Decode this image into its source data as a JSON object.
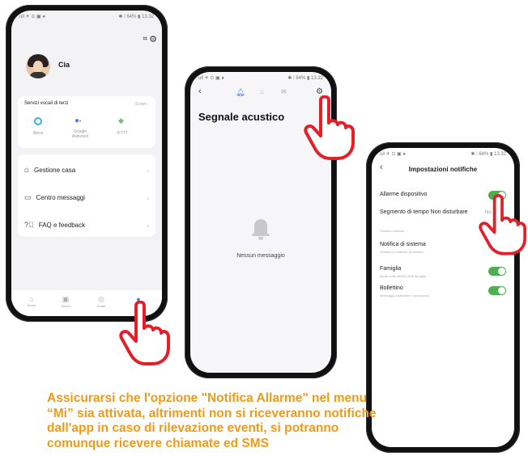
{
  "status_bar": {
    "left": "ull ✈ ⊙ ▣ ●",
    "right": "✱ ⁞ 64% ▮ 13.32"
  },
  "phone1": {
    "user_name": "Cia",
    "voice_services": {
      "title": "Servizi vocali di terzi",
      "more": "Scopri  ›",
      "items": [
        "Alexa",
        "Google Assistant",
        "IFTTT"
      ]
    },
    "menu": [
      "Gestione casa",
      "Centro messaggi",
      "FAQ e feedback"
    ],
    "nav": [
      "Home",
      "Scene",
      "Smart",
      "Mi"
    ]
  },
  "phone2": {
    "title": "Segnale acustico",
    "empty_message": "Nessun messaggio"
  },
  "phone3": {
    "header": "Impostazioni notifiche",
    "alarm_label": "Allarme dispositivo",
    "dnd_label": "Segmento di tempo Non disturbare",
    "dnd_value": "No",
    "section_label": "Sistema notifiche",
    "system_label": "Notifica di sistema",
    "system_sub": "Gestisci le notifiche di sistema",
    "family_label": "Famiglia",
    "family_sub": "Avvisi sulle attività della famiglia",
    "bulletin_label": "Bollettino",
    "bulletin_sub": "Messaggi pubblicitari e promozioni"
  },
  "caption": [
    "Assicurarsi che l'opzione \"Notifica Allarme\" nel menu",
    "“Mi” sia attivata, altrimenti non si riceveranno notifiche",
    "dall'app in caso di rilevazione eventi, si potranno",
    "comunque ricevere chiamate ed SMS"
  ],
  "colors": {
    "caption": "#f09a1a",
    "hand": "#e3202a",
    "toggle_on": "#4caf50",
    "accent": "#3b7cf5"
  }
}
